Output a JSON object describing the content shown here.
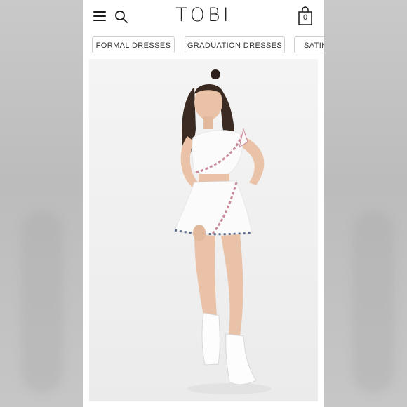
{
  "header": {
    "logo": "TOBI",
    "menu_icon": "hamburger-menu-icon",
    "search_icon": "search-icon",
    "cart_icon": "shopping-bag-icon",
    "cart_count": "0"
  },
  "categories": [
    {
      "label": "FORMAL DRESSES"
    },
    {
      "label": "GRADUATION DRESSES"
    },
    {
      "label": "SATIN"
    }
  ],
  "product_image": {
    "description_icon": "model-photo"
  },
  "colors": {
    "screen_bg": "#ffffff",
    "photo_bg": "#efefef",
    "text": "#222222",
    "chip_border": "#cfcfcf",
    "outfit": "#fbfbfb",
    "trim_pink": "#c98a9a",
    "trim_blue": "#5a6b8c",
    "hair": "#3b2a22",
    "skin": "#e9c2a8"
  }
}
